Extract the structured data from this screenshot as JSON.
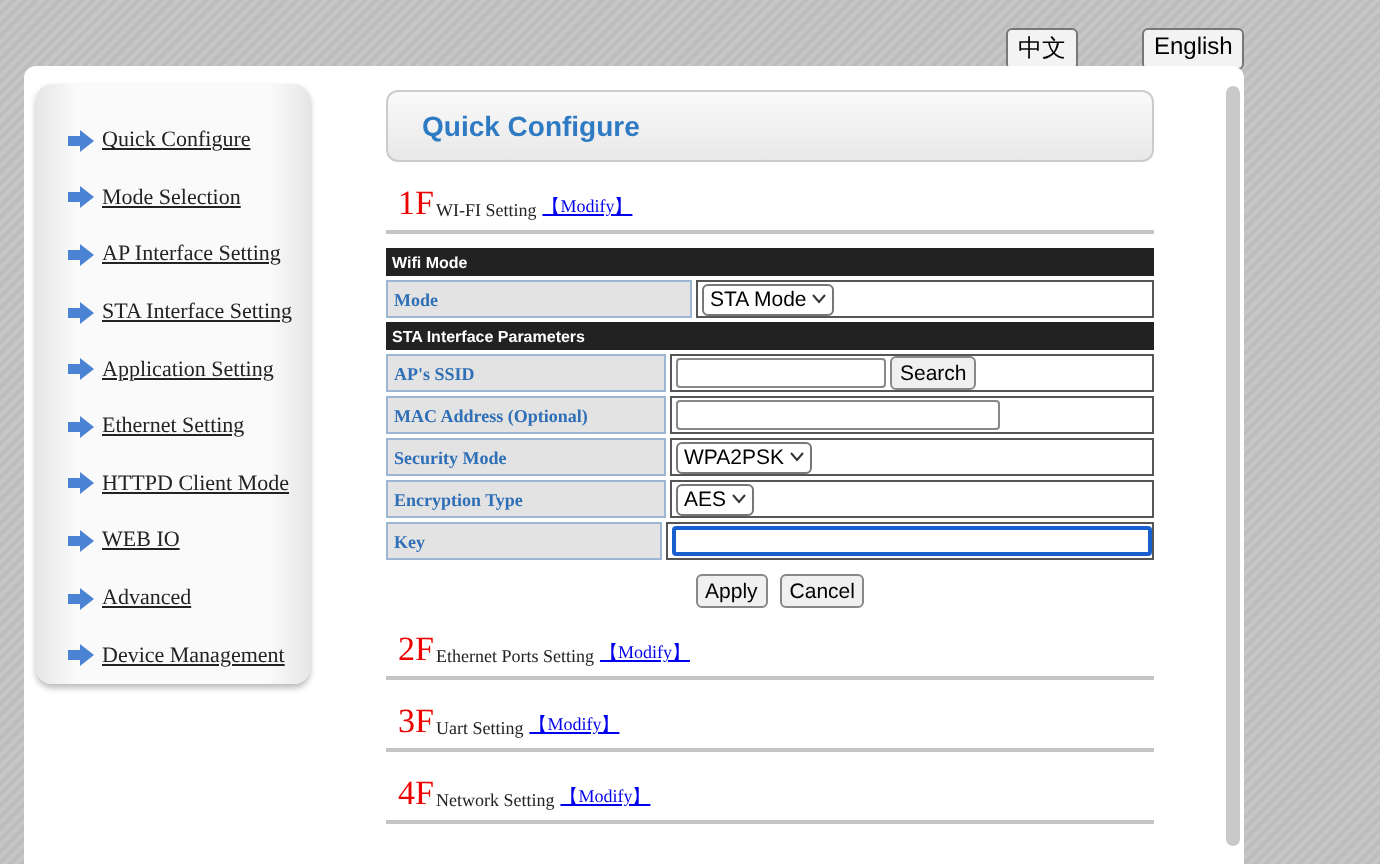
{
  "language_buttons": [
    {
      "label": "中文"
    },
    {
      "label": "English"
    }
  ],
  "sidebar": {
    "items": [
      {
        "label": "Quick Configure"
      },
      {
        "label": "Mode Selection"
      },
      {
        "label": "AP Interface Setting"
      },
      {
        "label": "STA Interface Setting"
      },
      {
        "label": "Application Setting"
      },
      {
        "label": "Ethernet Setting"
      },
      {
        "label": "HTTPD Client Mode"
      },
      {
        "label": "WEB IO"
      },
      {
        "label": "Advanced"
      },
      {
        "label": "Device Management"
      }
    ]
  },
  "page_title": "Quick Configure",
  "sections": [
    {
      "number": "1F",
      "title": "WI-FI Setting",
      "link": "【Modify】"
    },
    {
      "number": "2F",
      "title": "Ethernet Ports Setting",
      "link": "【Modify】"
    },
    {
      "number": "3F",
      "title": "Uart Setting",
      "link": "【Modify】"
    },
    {
      "number": "4F",
      "title": "Network Setting",
      "link": "【Modify】"
    }
  ],
  "wifi_table": {
    "groups": [
      {
        "header": "Wifi Mode",
        "rows": [
          {
            "label": "Mode",
            "kind": "select",
            "value": "STA Mode"
          }
        ]
      },
      {
        "header": "STA Interface Parameters",
        "rows": [
          {
            "label": "AP's SSID",
            "kind": "input_button",
            "button": "Search"
          },
          {
            "label": "MAC Address (Optional)",
            "kind": "input"
          },
          {
            "label": "Security Mode",
            "kind": "select",
            "value": "WPA2PSK"
          },
          {
            "label": "Encryption Type",
            "kind": "select",
            "value": "AES"
          },
          {
            "label": "Key",
            "kind": "input",
            "focused": true
          }
        ]
      }
    ]
  },
  "form_buttons": [
    {
      "label": "Apply"
    },
    {
      "label": "Cancel"
    }
  ]
}
